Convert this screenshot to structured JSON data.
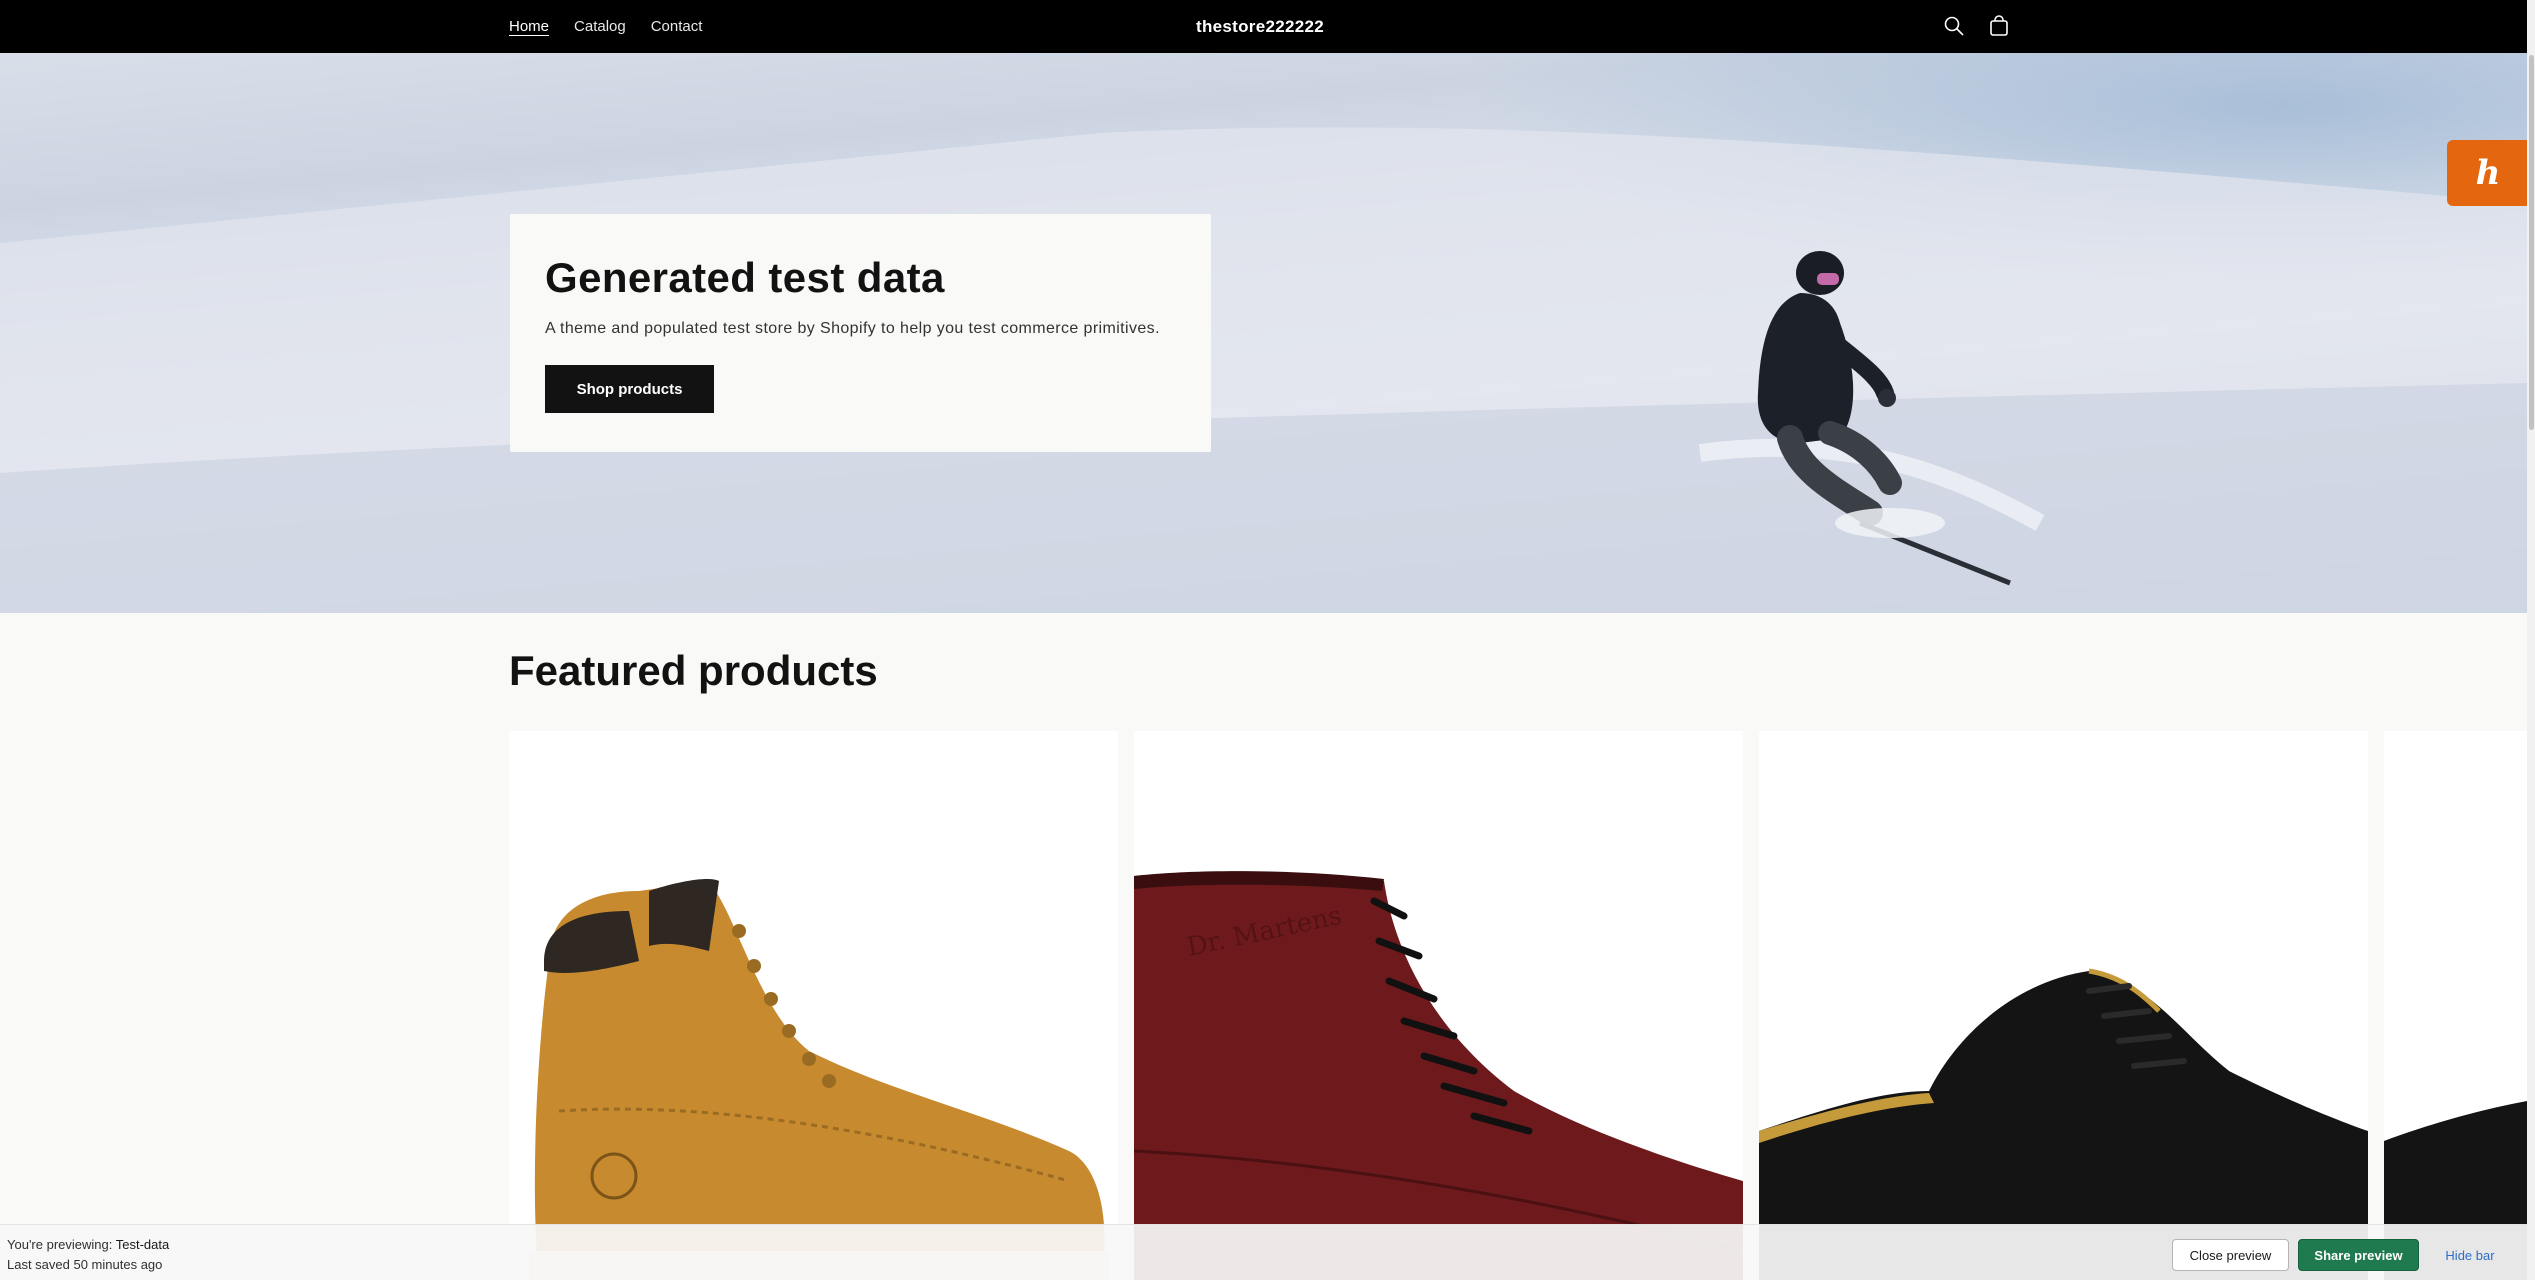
{
  "header": {
    "nav": [
      {
        "label": "Home",
        "active": true
      },
      {
        "label": "Catalog",
        "active": false
      },
      {
        "label": "Contact",
        "active": false
      }
    ],
    "brand": "thestore222222",
    "icons": [
      "search-icon",
      "cart-icon"
    ]
  },
  "hero": {
    "title": "Generated test data",
    "subtitle": "A theme and populated test store by Shopify to help you test commerce primitives.",
    "button": "Shop products"
  },
  "featured": {
    "title": "Featured products",
    "products": [
      {
        "image": "tan-work-boot"
      },
      {
        "image": "oxblood-leather-boot"
      },
      {
        "image": "black-leather-shoe"
      },
      {
        "image": "black-shoe-partial"
      }
    ]
  },
  "app_badge": {
    "glyph": "h",
    "color": "#e4670f"
  },
  "preview_bar": {
    "previewing_label": "You're previewing:",
    "theme_name": "Test-data",
    "last_saved": "Last saved 50 minutes ago",
    "close_button": "Close preview",
    "share_button": "Share preview",
    "hide_button": "Hide bar"
  },
  "colors": {
    "header_bg": "#000000",
    "page_bg": "#f9f9f7",
    "button_dark": "#121212",
    "share_green": "#1f7a4f",
    "link_blue": "#2c6ecb"
  }
}
